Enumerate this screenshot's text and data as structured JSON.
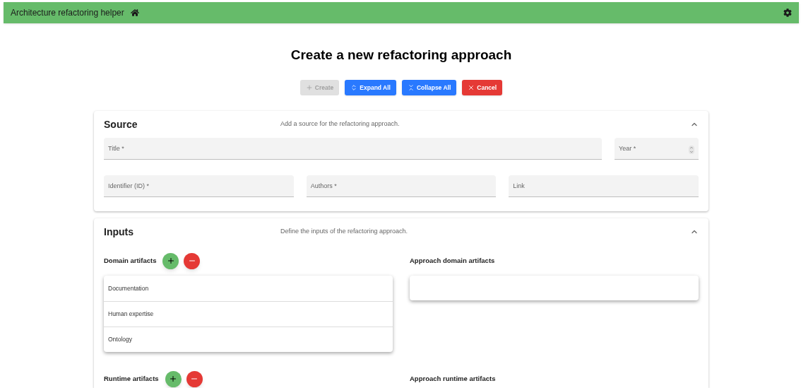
{
  "app_bar": {
    "title": "Architecture refactoring helper"
  },
  "page_title": "Create a new refactoring approach",
  "buttons": [
    {
      "label": "Create",
      "kind": "create",
      "disabled": true
    },
    {
      "label": "Expand All",
      "kind": "expand",
      "disabled": false
    },
    {
      "label": "Collapse All",
      "kind": "collapse",
      "disabled": false
    },
    {
      "label": "Cancel",
      "kind": "cancel",
      "disabled": false
    }
  ],
  "source": {
    "title": "Source",
    "description": "Add a source for the refactoring approach.",
    "expanded": true,
    "fields": [
      {
        "placeholder": "Title *",
        "kind": "text"
      },
      {
        "placeholder": "Year *",
        "kind": "number"
      },
      {
        "placeholder": "Identifier (ID) *",
        "kind": "text"
      },
      {
        "placeholder": "Authors *",
        "kind": "text"
      },
      {
        "placeholder": "Link",
        "kind": "text"
      }
    ]
  },
  "inputs": {
    "title": "Inputs",
    "description": "Define the inputs of the refactoring approach.",
    "expanded": true,
    "groups": [
      {
        "label": "Domain artifacts",
        "items": [
          "Documentation",
          "Human expertise",
          "Ontology"
        ],
        "approach_label": "Approach domain artifacts"
      },
      {
        "label": "Runtime artifacts",
        "approach_label": "Approach runtime artifacts"
      }
    ]
  }
}
